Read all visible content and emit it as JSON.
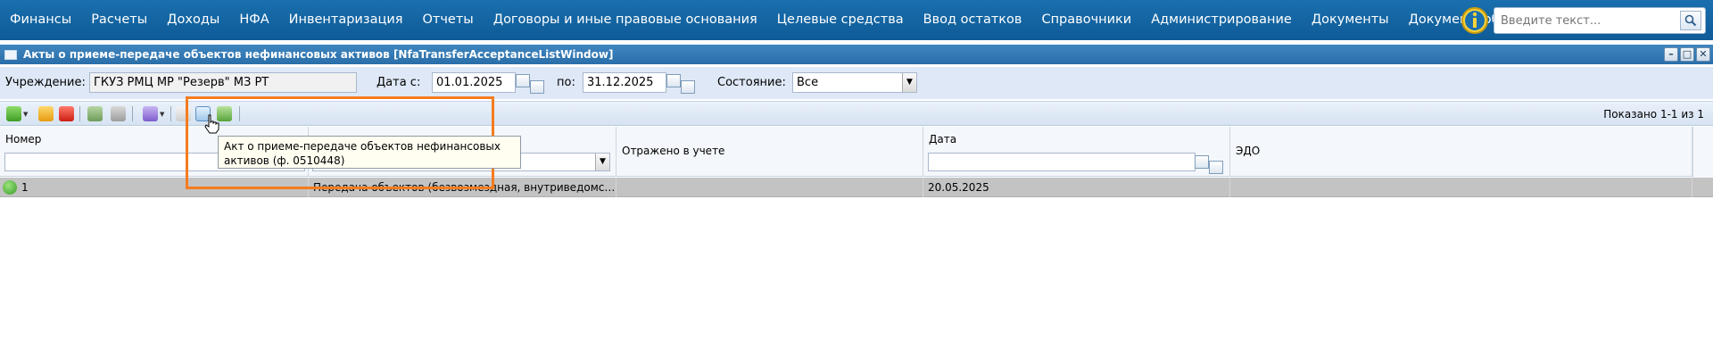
{
  "nav": {
    "items": [
      "Финансы",
      "Расчеты",
      "Доходы",
      "НФА",
      "Инвентаризация",
      "Отчеты",
      "Договоры и иные правовые основания",
      "Целевые средства",
      "Ввод остатков",
      "Справочники",
      "Администрирование",
      "Документы",
      "Документооборот"
    ],
    "search_placeholder": "Введите текст..."
  },
  "window": {
    "title": "Акты о приеме-передаче объектов нефинансовых активов [NfaTransferAcceptanceListWindow]"
  },
  "filters": {
    "institution_label": "Учреждение:",
    "institution_value": "ГКУЗ РМЦ МР \"Резерв\" МЗ РТ",
    "date_from_label": "Дата с:",
    "date_from_value": "01.01.2025",
    "date_to_label": "по:",
    "date_to_value": "31.12.2025",
    "state_label": "Состояние:",
    "state_value": "Все"
  },
  "toolbar": {
    "shown_text": "Показано 1-1 из 1"
  },
  "grid": {
    "columns": [
      "Номер",
      "",
      "Отражено в учете",
      "Дата",
      "ЭДО"
    ],
    "rows": [
      {
        "number": "1",
        "operation": "Передача объектов (безвозмездная, внутриведомствен...",
        "reflected": "",
        "date": "20.05.2025",
        "edo": ""
      }
    ]
  },
  "tooltip": {
    "line1": "Акт о приеме-передаче объектов нефинансовых",
    "line2": "активов (ф. 0510448)"
  },
  "colors": {
    "topbar": "#1a6fae",
    "window_header": "#2a6ea8",
    "highlight": "#f57c1f",
    "selected_row": "#c3c3c3"
  }
}
